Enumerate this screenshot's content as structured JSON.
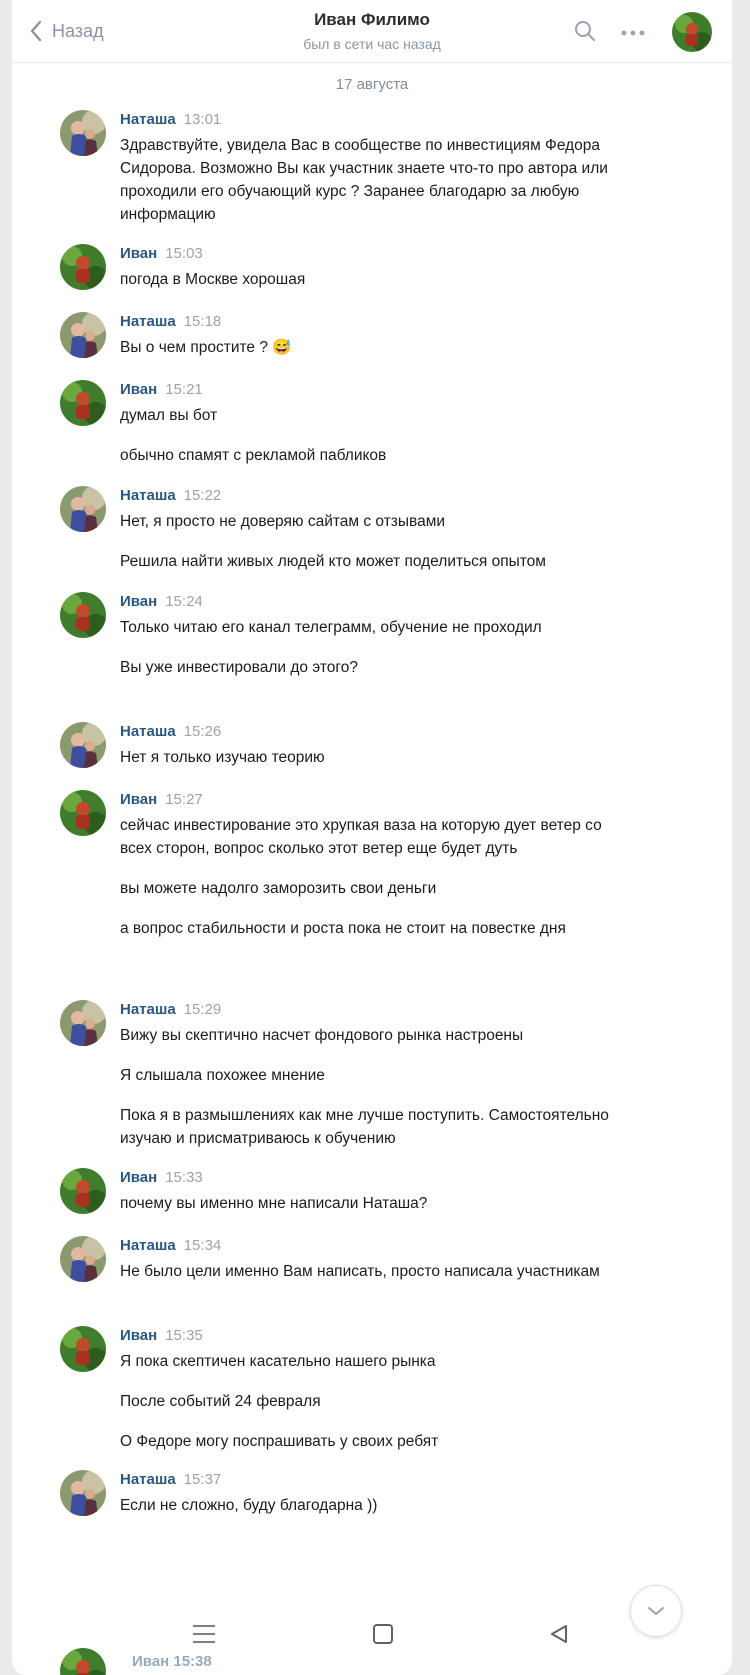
{
  "header": {
    "back_label": "Назад",
    "name": "Иван Филимо",
    "status": "был в сети час назад"
  },
  "date_separator": "17 августа",
  "colors": {
    "name_blue": "#2a5885",
    "meta_gray": "#9aa3ad",
    "background": "#e9eaec"
  },
  "messages": [
    {
      "sender": "Наташа",
      "time": "13:01",
      "avatar": "natasha",
      "texts": [
        "Здравствуйте, увидела Вас в сообществе по инвестициям Федора Сидорова. Возможно Вы как участник знаете что-то про автора или проходили его обучающий курс ? Заранее благодарю за любую информацию"
      ]
    },
    {
      "sender": "Иван",
      "time": "15:03",
      "avatar": "ivan",
      "texts": [
        "погода в Москве хорошая"
      ]
    },
    {
      "sender": "Наташа",
      "time": "15:18",
      "avatar": "natasha",
      "texts": [
        "Вы о чем простите ? 😅"
      ]
    },
    {
      "sender": "Иван",
      "time": "15:21",
      "avatar": "ivan",
      "texts": [
        "думал вы бот",
        "обычно спамят с рекламой пабликов"
      ]
    },
    {
      "sender": "Наташа",
      "time": "15:22",
      "avatar": "natasha",
      "texts": [
        "Нет, я просто не доверяю сайтам с отзывами",
        "Решила найти живых людей кто может поделиться опытом"
      ]
    },
    {
      "sender": "Иван",
      "time": "15:24",
      "avatar": "ivan",
      "texts": [
        "Только читаю его канал телеграмм, обучение не проходил",
        "Вы уже инвестировали до этого?"
      ]
    },
    {
      "sender": "Наташа",
      "time": "15:26",
      "avatar": "natasha",
      "texts": [
        "Нет я только изучаю теорию"
      ]
    },
    {
      "sender": "Иван",
      "time": "15:27",
      "avatar": "ivan",
      "texts": [
        "сейчас инвестирование это хрупкая ваза на которую дует ветер со всех сторон, вопрос сколько этот ветер еще будет дуть",
        "вы можете надолго заморозить свои деньги",
        "а вопрос стабильности и роста пока не стоит на повестке дня"
      ]
    },
    {
      "sender": "Наташа",
      "time": "15:29",
      "avatar": "natasha",
      "texts": [
        "Вижу вы скептично насчет фондового рынка настроены",
        "Я слышала похожее мнение",
        "Пока я в размышлениях как мне лучше поступить. Самостоятельно изучаю и присматриваюсь к обучению"
      ]
    },
    {
      "sender": "Иван",
      "time": "15:33",
      "avatar": "ivan",
      "texts": [
        "почему вы именно мне написали Наташа?"
      ]
    },
    {
      "sender": "Наташа",
      "time": "15:34",
      "avatar": "natasha",
      "texts": [
        "Не было цели именно Вам написать, просто написала участникам"
      ]
    },
    {
      "sender": "Иван",
      "time": "15:35",
      "avatar": "ivan",
      "texts": [
        "Я пока скептичен касательно нашего рынка",
        "После событий 24 февраля",
        "О Федоре могу поспрашивать у своих ребят"
      ]
    },
    {
      "sender": "Наташа",
      "time": "15:37",
      "avatar": "natasha",
      "texts": [
        "Если не сложно, буду благодарна ))"
      ]
    }
  ],
  "next_peek": "Иван 15:38",
  "icons": {
    "back": "chevron-left-icon",
    "search": "search-icon",
    "more": "more-horizontal-icon",
    "scroll_down": "chevron-down-icon",
    "nav_menu": "menu-icon",
    "nav_home": "square-icon",
    "nav_back": "triangle-back-icon"
  }
}
